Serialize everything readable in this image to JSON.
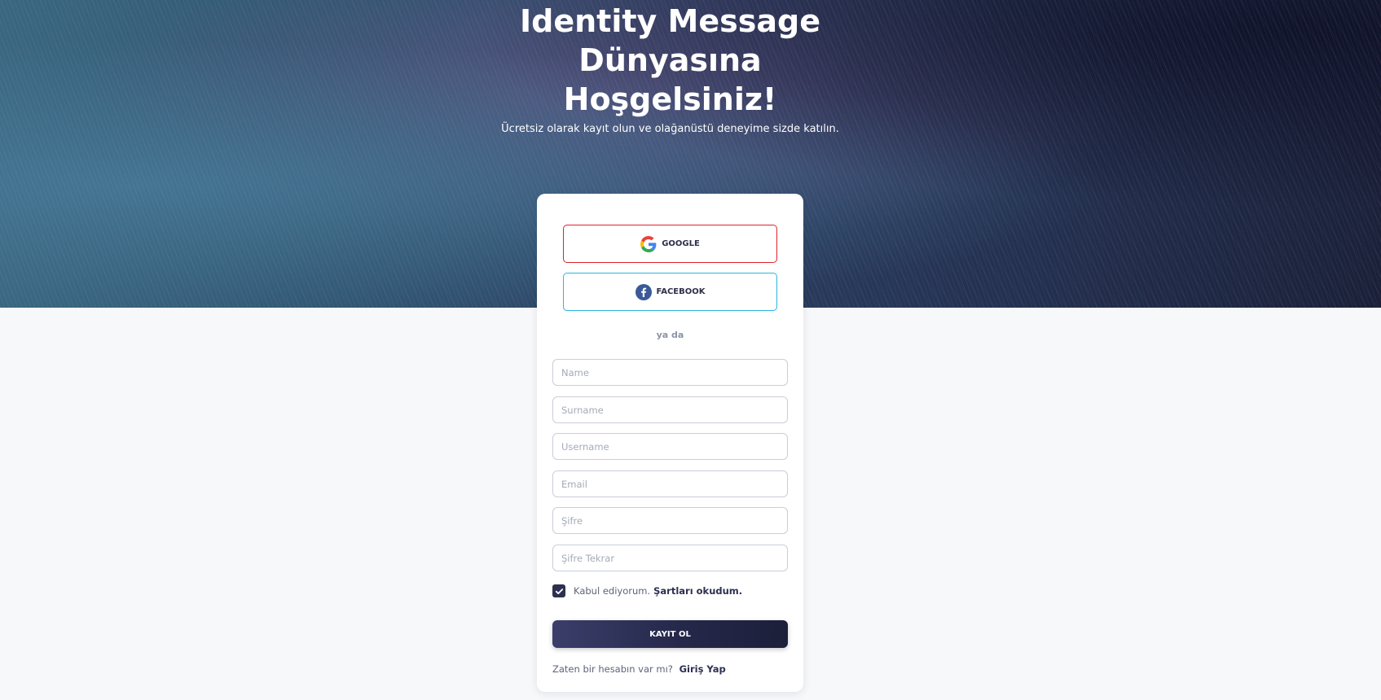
{
  "hero": {
    "title_lines": [
      "Identity Message",
      "Dünyasına",
      "Hoşgelsiniz!"
    ],
    "subtitle": "Ücretsiz olarak kayıt olun ve olağanüstü deneyime sizde katılın."
  },
  "social": {
    "google_label": "GOOGLE",
    "facebook_label": "FACEBOOK",
    "google_border_color": "#e0222a",
    "facebook_border_color": "#2bb5df"
  },
  "divider": {
    "text": "ya da"
  },
  "form": {
    "name_placeholder": "Name",
    "surname_placeholder": "Surname",
    "username_placeholder": "Username",
    "email_placeholder": "Email",
    "password_placeholder": "Şifre",
    "password_repeat_placeholder": "Şifre Tekrar",
    "terms_checked": true,
    "terms_text": "Kabul ediyorum.",
    "terms_link": "Şartları okudum.",
    "submit_label": "KAYIT OL"
  },
  "footer": {
    "question": "Zaten bir hesabın var mı?",
    "login_link": "Giriş Yap"
  },
  "colors": {
    "primary": "#2d3050",
    "page_background": "#f7f8fa"
  },
  "icons": {
    "google": "google-logo-icon",
    "facebook": "facebook-logo-icon",
    "checkbox": "checkmark-icon"
  }
}
